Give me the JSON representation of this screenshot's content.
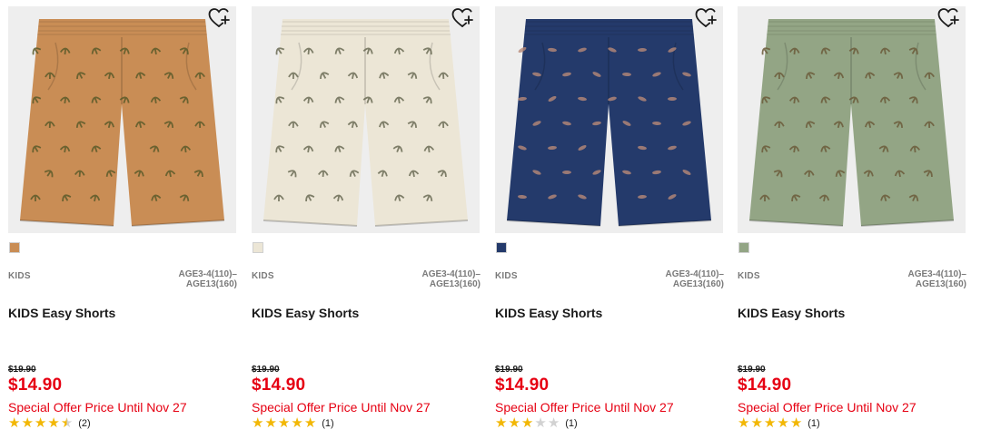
{
  "products": [
    {
      "category": "KIDS",
      "sizes": "AGE3-4(110)–\nAGE13(160)",
      "name": "KIDS Easy Shorts",
      "original_price": "$19.90",
      "price": "$14.90",
      "offer": "Special Offer Price Until Nov 27",
      "rating": 4.5,
      "review_count": "(2)",
      "color": "#c98d55",
      "motif_color": "#5a5a2a",
      "swatch_color": "#c98d55",
      "icon": "heart-plus-icon"
    },
    {
      "category": "KIDS",
      "sizes": "AGE3-4(110)–\nAGE13(160)",
      "name": "KIDS Easy Shorts",
      "original_price": "$19.90",
      "price": "$14.90",
      "offer": "Special Offer Price Until Nov 27",
      "rating": 5,
      "review_count": "(1)",
      "color": "#ece6d6",
      "motif_color": "#6b6b55",
      "swatch_color": "#ece6d6",
      "icon": "heart-plus-icon"
    },
    {
      "category": "KIDS",
      "sizes": "AGE3-4(110)–\nAGE13(160)",
      "name": "KIDS Easy Shorts",
      "original_price": "$19.90",
      "price": "$14.90",
      "offer": "Special Offer Price Until Nov 27",
      "rating": 3,
      "review_count": "(1)",
      "color": "#243a6b",
      "motif_color": "#b88a78",
      "swatch_color": "#243a6b",
      "icon": "heart-plus-icon"
    },
    {
      "category": "KIDS",
      "sizes": "AGE3-4(110)–\nAGE13(160)",
      "name": "KIDS Easy Shorts",
      "original_price": "$19.90",
      "price": "$14.90",
      "offer": "Special Offer Price Until Nov 27",
      "rating": 5,
      "review_count": "(1)",
      "color": "#93a585",
      "motif_color": "#6b5a3a",
      "swatch_color": "#93a585",
      "icon": "heart-plus-icon"
    }
  ]
}
